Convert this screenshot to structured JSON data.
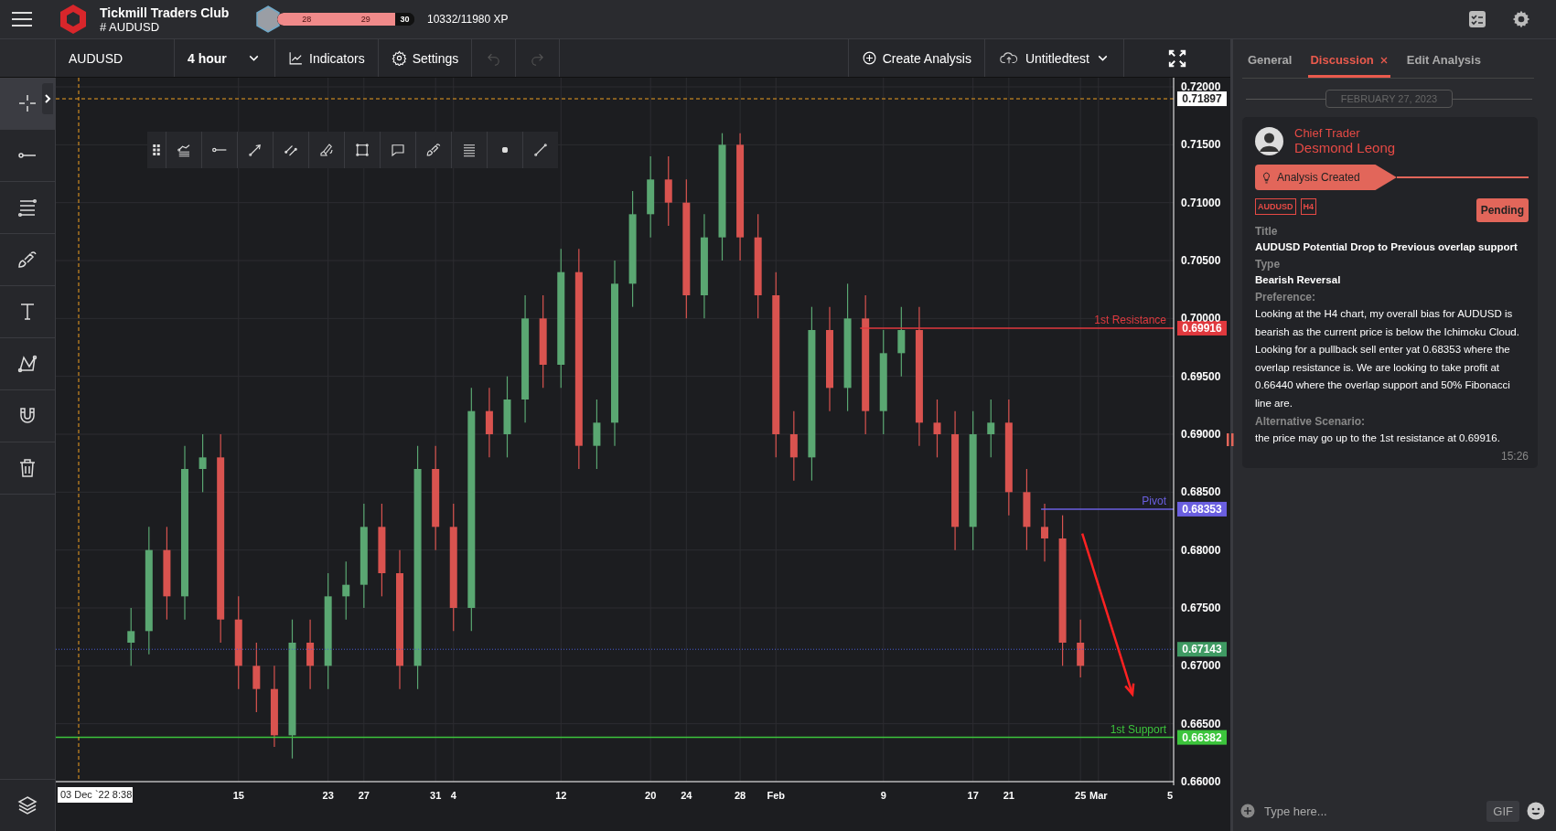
{
  "header": {
    "app_name": "Tickmill Traders Club",
    "channel": "# AUDUSD",
    "xp_bar": {
      "levels": [
        "28",
        "29",
        "30"
      ],
      "level": 0.86
    },
    "xp_text": "10332/11980 XP"
  },
  "toolbar": {
    "symbol": "AUDUSD",
    "timeframe": "4 hour",
    "buttons": [
      {
        "kind": "indicators",
        "label": "Indicators"
      },
      {
        "kind": "settings",
        "label": "Settings"
      }
    ],
    "history": [
      {
        "kind": "undo",
        "disabled": true
      },
      {
        "kind": "redo",
        "disabled": true
      }
    ],
    "create": "Create Analysis",
    "save": "Untitledtest"
  },
  "sidebar": {
    "tools": [
      {
        "kind": "crosshair",
        "selected": true
      },
      {
        "kind": "ray",
        "selected": false
      },
      {
        "kind": "fib-lines",
        "selected": false
      },
      {
        "kind": "brush",
        "selected": false
      },
      {
        "kind": "text",
        "selected": false
      },
      {
        "kind": "pattern",
        "selected": false
      },
      {
        "kind": "magnet",
        "selected": false
      },
      {
        "kind": "trash",
        "selected": false
      },
      {
        "kind": "layers",
        "selected": false
      }
    ]
  },
  "drawing_toolbar": {
    "tools": [
      {
        "kind": "grip"
      },
      {
        "kind": "fib-fan"
      },
      {
        "kind": "ray"
      },
      {
        "kind": "arrow-line"
      },
      {
        "kind": "parallel"
      },
      {
        "kind": "highlighter"
      },
      {
        "kind": "rectangle"
      },
      {
        "kind": "callout"
      },
      {
        "kind": "brush"
      },
      {
        "kind": "lines"
      },
      {
        "kind": "dot"
      },
      {
        "kind": "segment"
      }
    ]
  },
  "chart": {
    "chart_data": {
      "type": "candlestick",
      "grid": true,
      "ylim": [
        0.66,
        0.72
      ],
      "categories": [
        null,
        null,
        null,
        null,
        null,
        null,
        null,
        null,
        null,
        null,
        "15",
        null,
        null,
        null,
        null,
        "23",
        null,
        "27",
        null,
        null,
        null,
        "31",
        "4",
        null,
        null,
        null,
        null,
        null,
        "12",
        null,
        null,
        null,
        null,
        "20",
        null,
        "24",
        null,
        null,
        "28",
        null,
        "Feb",
        null,
        null,
        null,
        null,
        null,
        "9",
        null,
        null,
        null,
        null,
        "17",
        null,
        "21",
        null,
        null,
        null,
        "25",
        "Mar",
        null,
        null,
        null,
        "5"
      ],
      "ohlc": [
        null,
        null,
        null,
        null,
        [
          0.672,
          0.675,
          0.67,
          0.673
        ],
        [
          0.673,
          0.682,
          0.671,
          0.68
        ],
        [
          0.68,
          0.682,
          0.674,
          0.676
        ],
        [
          0.676,
          0.689,
          0.674,
          0.687
        ],
        [
          0.687,
          0.69,
          0.685,
          0.688
        ],
        [
          0.688,
          0.69,
          0.672,
          0.674
        ],
        [
          0.674,
          0.676,
          0.668,
          0.67
        ],
        [
          0.67,
          0.672,
          0.666,
          0.668
        ],
        [
          0.668,
          0.67,
          0.663,
          0.664
        ],
        [
          0.664,
          0.674,
          0.662,
          0.672
        ],
        [
          0.672,
          0.674,
          0.668,
          0.67
        ],
        [
          0.67,
          0.678,
          0.668,
          0.676
        ],
        [
          0.676,
          0.679,
          0.674,
          0.677
        ],
        [
          0.677,
          0.684,
          0.675,
          0.682
        ],
        [
          0.682,
          0.684,
          0.676,
          0.678
        ],
        [
          0.678,
          0.68,
          0.668,
          0.67
        ],
        [
          0.67,
          0.689,
          0.668,
          0.687
        ],
        [
          0.687,
          0.689,
          0.68,
          0.682
        ],
        [
          0.682,
          0.684,
          0.673,
          0.675
        ],
        [
          0.675,
          0.694,
          0.673,
          0.692
        ],
        [
          0.692,
          0.694,
          0.688,
          0.69
        ],
        [
          0.69,
          0.695,
          0.688,
          0.693
        ],
        [
          0.693,
          0.702,
          0.691,
          0.7
        ],
        [
          0.7,
          0.702,
          0.694,
          0.696
        ],
        [
          0.696,
          0.706,
          0.694,
          0.704
        ],
        [
          0.704,
          0.706,
          0.687,
          0.689
        ],
        [
          0.689,
          0.693,
          0.687,
          0.691
        ],
        [
          0.691,
          0.705,
          0.689,
          0.703
        ],
        [
          0.703,
          0.711,
          0.701,
          0.709
        ],
        [
          0.709,
          0.714,
          0.707,
          0.712
        ],
        [
          0.712,
          0.714,
          0.708,
          0.71
        ],
        [
          0.71,
          0.712,
          0.7,
          0.702
        ],
        [
          0.702,
          0.709,
          0.7,
          0.707
        ],
        [
          0.707,
          0.716,
          0.705,
          0.715
        ],
        [
          0.715,
          0.716,
          0.705,
          0.707
        ],
        [
          0.707,
          0.709,
          0.7,
          0.702
        ],
        [
          0.702,
          0.704,
          0.688,
          0.69
        ],
        [
          0.69,
          0.692,
          0.686,
          0.688
        ],
        [
          0.688,
          0.701,
          0.686,
          0.699
        ],
        [
          0.699,
          0.701,
          0.692,
          0.694
        ],
        [
          0.694,
          0.703,
          0.692,
          0.7
        ],
        [
          0.7,
          0.702,
          0.69,
          0.692
        ],
        [
          0.692,
          0.699,
          0.69,
          0.697
        ],
        [
          0.697,
          0.701,
          0.695,
          0.699
        ],
        [
          0.699,
          0.701,
          0.689,
          0.691
        ],
        [
          0.691,
          0.693,
          0.688,
          0.69
        ],
        [
          0.69,
          0.692,
          0.68,
          0.682
        ],
        [
          0.682,
          0.692,
          0.68,
          0.69
        ],
        [
          0.69,
          0.693,
          0.688,
          0.691
        ],
        [
          0.691,
          0.693,
          0.683,
          0.685
        ],
        [
          0.685,
          0.687,
          0.68,
          0.682
        ],
        [
          0.682,
          0.684,
          0.679,
          0.681
        ],
        [
          0.681,
          0.683,
          0.67,
          0.672
        ],
        [
          0.672,
          0.674,
          0.669,
          0.67
        ],
        null,
        null,
        null,
        null,
        null
      ],
      "yticks": [
        {
          "value": 0.66,
          "label": "0.66000"
        },
        {
          "value": 0.665,
          "label": "0.66500"
        },
        {
          "value": 0.67,
          "label": "0.67000"
        },
        {
          "value": 0.675,
          "label": "0.67500"
        },
        {
          "value": 0.68,
          "label": "0.68000"
        },
        {
          "value": 0.685,
          "label": "0.68500"
        },
        {
          "value": 0.69,
          "label": "0.69000"
        },
        {
          "value": 0.695,
          "label": "0.69500"
        },
        {
          "value": 0.7,
          "label": "0.70000"
        },
        {
          "value": 0.705,
          "label": "0.70500"
        },
        {
          "value": 0.71,
          "label": "0.71000"
        },
        {
          "value": 0.715,
          "label": "0.71500"
        },
        {
          "value": 0.72,
          "label": "0.72000"
        }
      ],
      "ref_lines": [
        {
          "axis": "y",
          "value": 0.71897,
          "color": "#f0a020"
        },
        {
          "axis": "y",
          "value": 0.69916,
          "label": "1st Resistance",
          "color": "#e0393e"
        },
        {
          "axis": "y",
          "value": 0.68353,
          "label": "Pivot",
          "color": "#6a5fe0"
        },
        {
          "axis": "y",
          "value": 0.67143,
          "color": "#4a5bd0"
        },
        {
          "axis": "y",
          "value": 0.66382,
          "label": "1st Support",
          "color": "#3cc43c"
        }
      ]
    },
    "price_tags": [
      {
        "text": "0.71897",
        "kind": "crosshair"
      },
      {
        "text": "0.69916",
        "kind": "level",
        "color": "#e0393e"
      },
      {
        "text": "0.68353",
        "kind": "level",
        "color": "#6a5fe0"
      },
      {
        "text": "0.67143",
        "kind": "level",
        "color": "#3f9a63"
      },
      {
        "text": "0.66382",
        "kind": "level",
        "color": "#3cc43c"
      }
    ],
    "cursor_time": "03 Dec `22 8:38"
  },
  "panel": {
    "tabs": [
      {
        "label": "General",
        "selected": false,
        "closable": false
      },
      {
        "label": "Discussion",
        "selected": true,
        "closable": true
      },
      {
        "label": "Edit Analysis",
        "selected": false,
        "closable": false
      }
    ],
    "date": "FEBRUARY 27, 2023",
    "post": {
      "role": "Chief Trader",
      "author": "Desmond Leong",
      "event": "Analysis Created",
      "tags": [
        "AUDUSD",
        "H4"
      ],
      "status": "Pending",
      "fields": [
        {
          "label": "Title",
          "value": "AUDUSD Potential Drop to Previous overlap support",
          "kind": "bold"
        },
        {
          "label": "Type",
          "value": "Bearish Reversal",
          "kind": "bold"
        },
        {
          "label": "Preference:",
          "value": "Looking at the H4 chart, my overall bias for AUDUSD is bearish as the current price is below the Ichimoku Cloud. Looking for a pullback sell enter yat 0.68353 where the overlap resistance is. We are looking to take profit at 0.66440 where the overlap support and 50% Fibonacci line are.",
          "kind": "plain"
        },
        {
          "label": "Alternative Scenario:",
          "value": "the price may go up to the 1st resistance at 0.69916.",
          "kind": "plain"
        }
      ],
      "time": "15:26"
    },
    "composer": {
      "placeholder": "Type here...",
      "gif": "GIF"
    }
  }
}
